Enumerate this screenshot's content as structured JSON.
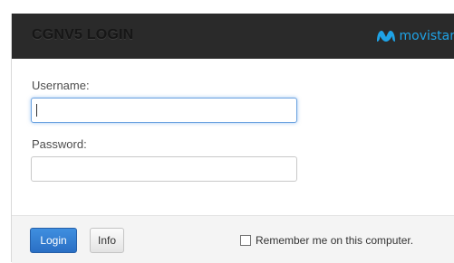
{
  "header": {
    "title": "CGNV5 LOGIN",
    "brand": "movistar"
  },
  "form": {
    "username_label": "Username:",
    "username_value": "",
    "password_label": "Password:",
    "password_value": ""
  },
  "footer": {
    "login_label": "Login",
    "info_label": "Info",
    "remember_label": "Remember me on this computer.",
    "remember_checked": false
  },
  "colors": {
    "header_bg": "#2a2a2a",
    "brand": "#1fa3e6",
    "primary_button": "#2f7ad4",
    "footer_bg": "#f4f4f4"
  },
  "icons": {
    "brand_logo": "movistar-m-logo",
    "checkbox": "checkbox-unchecked"
  }
}
